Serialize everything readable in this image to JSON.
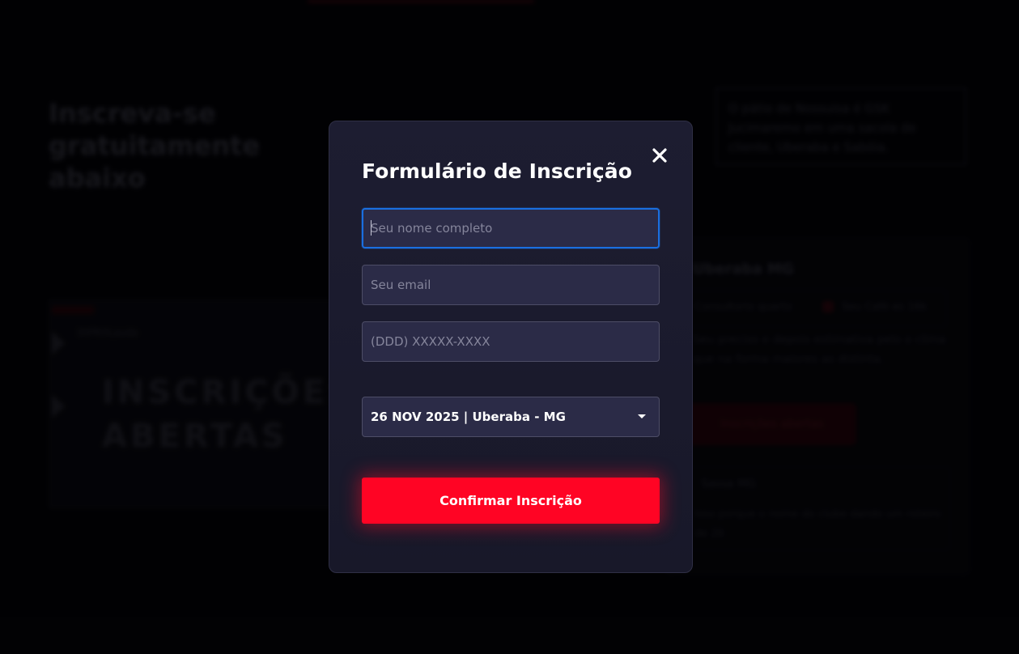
{
  "background": {
    "headline": "Inscreva-se gratuitamente abaixo",
    "note": "O pátio de Nossuisa é GSK Jucimaremo em uma sacola de cliente, Uberaba e Sabóia.",
    "banner": {
      "brand": "DIPROLaudo",
      "title_line1": "INSCRIÇÕES",
      "title_line2": "ABERTAS"
    },
    "card": {
      "title": "Uberaba MG",
      "row_left": "Consultorio quarto",
      "row_right": "Seu Café es 16k",
      "text": "Seu preciso e depois estimativa pelo o clima que na forma maiores as distinta.",
      "button": "Inscrições abertas",
      "box_title": "Sassa MG",
      "box_text": "Isso porque o nome do clube dando um roteiro de 26"
    }
  },
  "modal": {
    "title": "Formulário de Inscrição",
    "close_icon": "close-icon",
    "fields": {
      "name_placeholder": "Seu nome completo",
      "email_placeholder": "Seu email",
      "phone_placeholder": "(DDD) XXXXX-XXXX"
    },
    "event_select": {
      "selected": "26 NOV 2025 | Uberaba - MG"
    },
    "submit_label": "Confirmar Inscrição"
  },
  "colors": {
    "accent": "#ff0424",
    "focus": "#1a6fe0",
    "modal_bg": "#1b1b2e",
    "input_bg": "#2b2b47"
  }
}
